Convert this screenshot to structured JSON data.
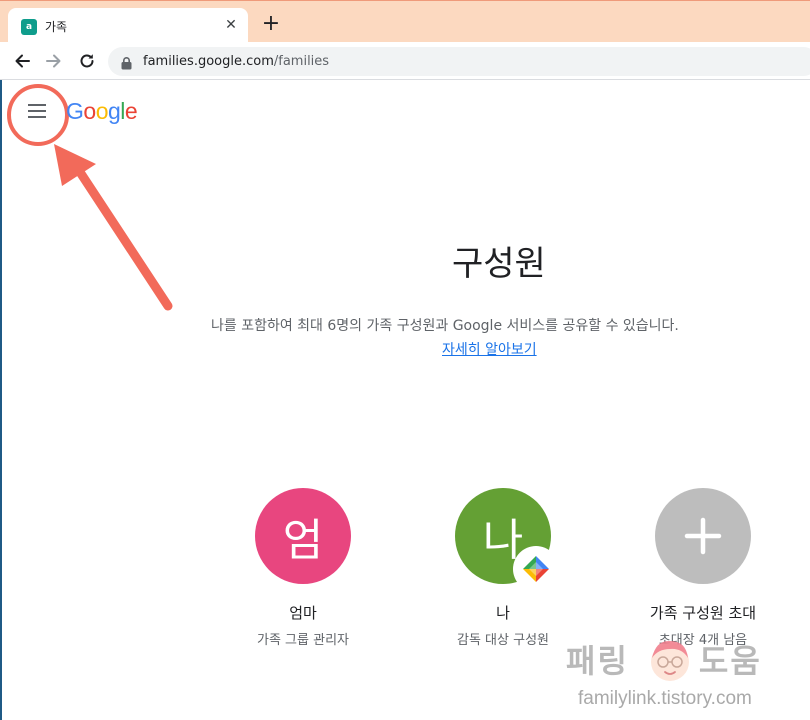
{
  "browser": {
    "tab_title": "가족",
    "favicon_letter": "a",
    "close_glyph": "✕",
    "newtab_glyph": "+",
    "url_host": "families.google.com",
    "url_path": "/families"
  },
  "header": {
    "logo_letters": [
      {
        "ch": "G",
        "color": "#4285F4"
      },
      {
        "ch": "o",
        "color": "#EA4335"
      },
      {
        "ch": "o",
        "color": "#FBBC05"
      },
      {
        "ch": "g",
        "color": "#4285F4"
      },
      {
        "ch": "l",
        "color": "#34A853"
      },
      {
        "ch": "e",
        "color": "#EA4335"
      }
    ]
  },
  "main": {
    "heading": "구성원",
    "description": "나를 포함하여 최대 6명의 가족 구성원과 Google 서비스를 공유할 수 있습니다.",
    "learn_more": "자세히 알아보기"
  },
  "members": [
    {
      "initial": "엄",
      "name": "엄마",
      "role": "가족 그룹 관리자",
      "color": "#e8467f"
    },
    {
      "initial": "나",
      "name": "나",
      "role": "감독 대상 구성원",
      "color": "#64a034",
      "badge": "family-link-icon"
    },
    {
      "initial": "+",
      "name": "가족 구성원 초대",
      "role": "초대장 4개 남음",
      "color": "#bdbdbd"
    }
  ],
  "watermark": {
    "left": "패링",
    "right": "도움",
    "url": "familylink.tistory.com"
  },
  "colors": {
    "annotation_red": "#f26a5a",
    "tabstrip": "#fcd9c0"
  }
}
